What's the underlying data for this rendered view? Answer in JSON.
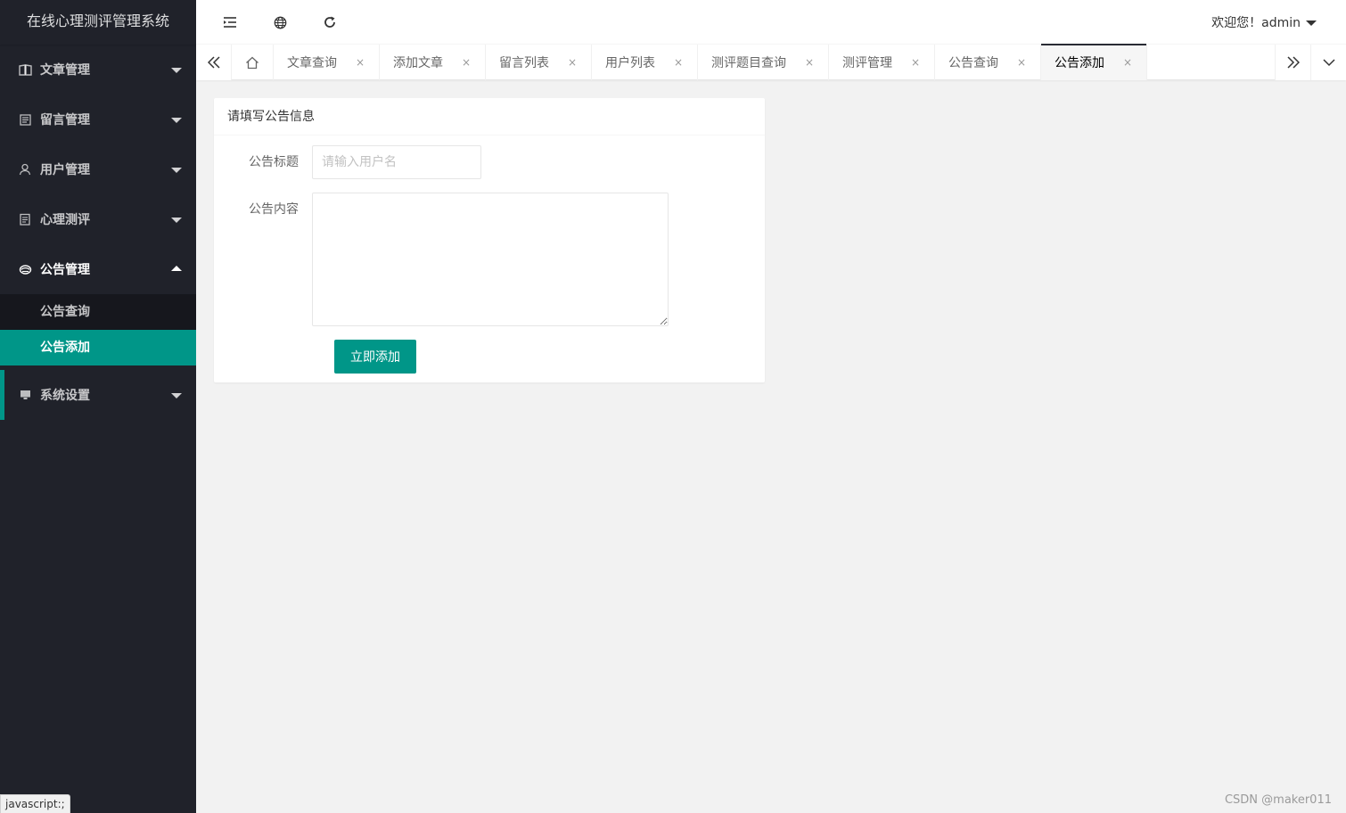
{
  "app": {
    "title": "在线心理测评管理系统"
  },
  "sidebar": {
    "menus": [
      {
        "label": "文章管理",
        "icon": "book-icon"
      },
      {
        "label": "留言管理",
        "icon": "message-icon"
      },
      {
        "label": "用户管理",
        "icon": "user-icon"
      },
      {
        "label": "心理测评",
        "icon": "clipboard-icon"
      },
      {
        "label": "公告管理",
        "icon": "announcement-icon",
        "expanded": true
      },
      {
        "label": "系统设置",
        "icon": "monitor-icon"
      }
    ],
    "submenu": [
      {
        "label": "公告查询"
      },
      {
        "label": "公告添加",
        "selected": true
      }
    ]
  },
  "header": {
    "welcome": "欢迎您！admin",
    "icons": [
      "collapse-menu-icon",
      "globe-icon",
      "refresh-icon"
    ]
  },
  "tabs": {
    "home_icon": "home-icon",
    "items": [
      {
        "label": "文章查询"
      },
      {
        "label": "添加文章"
      },
      {
        "label": "留言列表"
      },
      {
        "label": "用户列表"
      },
      {
        "label": "测评题目查询"
      },
      {
        "label": "测评管理"
      },
      {
        "label": "公告查询"
      },
      {
        "label": "公告添加",
        "active": true
      }
    ],
    "close_glyph": "×"
  },
  "form": {
    "heading": "请填写公告信息",
    "title_label": "公告标题",
    "title_placeholder": "请输入用户名",
    "title_value": "",
    "content_label": "公告内容",
    "content_value": "",
    "submit_label": "立即添加"
  },
  "status_bar": {
    "link_preview": "javascript:;"
  },
  "watermark": "CSDN @maker011",
  "colors": {
    "accent": "#009688",
    "sidebar_bg": "#20222a",
    "tab_active_indicator": "#292b34"
  }
}
